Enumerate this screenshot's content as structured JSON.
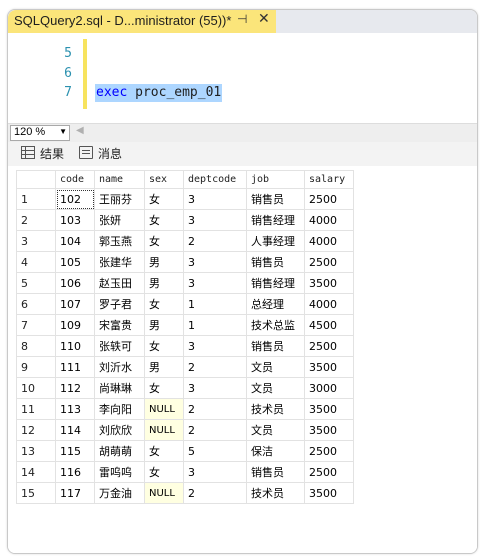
{
  "tab": {
    "title": "SQLQuery2.sql - D...ministrator (55))*",
    "pin_glyph": "⊣",
    "close_glyph": "✕"
  },
  "editor": {
    "lines": [
      {
        "num": "5",
        "text": ""
      },
      {
        "num": "6",
        "text": ""
      },
      {
        "num": "7",
        "keyword": "exec",
        "identifier": "proc_emp_01"
      }
    ]
  },
  "zoom": {
    "value": "120 %"
  },
  "result_tabs": {
    "results_label": "结果",
    "messages_label": "消息"
  },
  "grid": {
    "columns": [
      "code",
      "name",
      "sex",
      "deptcode",
      "job",
      "salary"
    ],
    "rows": [
      [
        "1",
        "102",
        "王丽芬",
        "女",
        "3",
        "销售员",
        "2500"
      ],
      [
        "2",
        "103",
        "张妍",
        "女",
        "3",
        "销售经理",
        "4000"
      ],
      [
        "3",
        "104",
        "郭玉燕",
        "女",
        "2",
        "人事经理",
        "4000"
      ],
      [
        "4",
        "105",
        "张建华",
        "男",
        "3",
        "销售员",
        "2500"
      ],
      [
        "5",
        "106",
        "赵玉田",
        "男",
        "3",
        "销售经理",
        "3500"
      ],
      [
        "6",
        "107",
        "罗子君",
        "女",
        "1",
        "总经理",
        "4000"
      ],
      [
        "7",
        "109",
        "宋富贵",
        "男",
        "1",
        "技术总监",
        "4500"
      ],
      [
        "8",
        "110",
        "张轶可",
        "女",
        "3",
        "销售员",
        "2500"
      ],
      [
        "9",
        "111",
        "刘沂水",
        "男",
        "2",
        "文员",
        "3500"
      ],
      [
        "10",
        "112",
        "尚琳琳",
        "女",
        "3",
        "文员",
        "3000"
      ],
      [
        "11",
        "113",
        "李向阳",
        "NULL",
        "2",
        "技术员",
        "3500"
      ],
      [
        "12",
        "114",
        "刘欣欣",
        "NULL",
        "2",
        "文员",
        "3500"
      ],
      [
        "13",
        "115",
        "胡萌萌",
        "女",
        "5",
        "保洁",
        "2500"
      ],
      [
        "14",
        "116",
        "雷呜呜",
        "女",
        "3",
        "销售员",
        "2500"
      ],
      [
        "15",
        "117",
        "万金油",
        "NULL",
        "2",
        "技术员",
        "3500"
      ]
    ]
  },
  "colors": {
    "tab_active": "#fbe57a",
    "keyword": "#0000ff",
    "selection": "#add6ff",
    "null_cell": "#ffffe1",
    "line_number": "#2b91af"
  }
}
